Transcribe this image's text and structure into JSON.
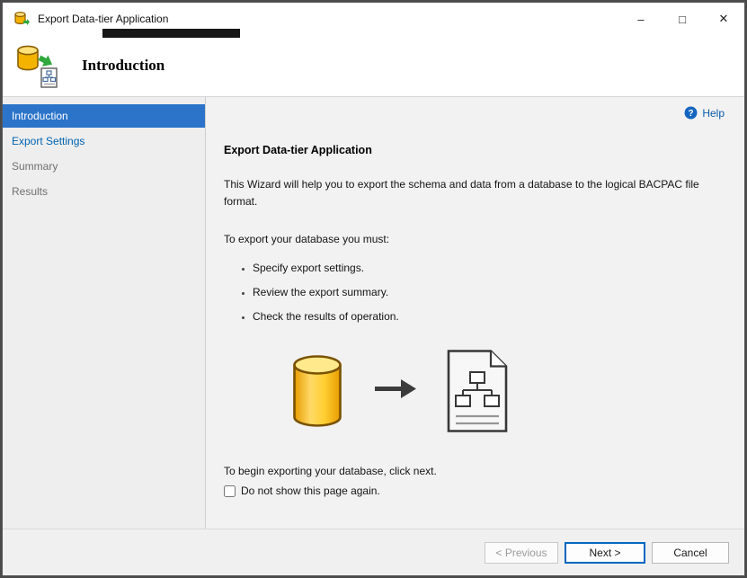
{
  "window": {
    "title": "Export Data-tier Application",
    "controls": {
      "minimize": "–",
      "maximize": "□",
      "close": "✕"
    }
  },
  "header": {
    "title": "Introduction"
  },
  "sidebar": {
    "items": [
      {
        "label": "Introduction",
        "state": "selected"
      },
      {
        "label": "Export Settings",
        "state": "link"
      },
      {
        "label": "Summary",
        "state": "disabled"
      },
      {
        "label": "Results",
        "state": "disabled"
      }
    ]
  },
  "content": {
    "help_label": "Help",
    "heading": "Export Data-tier Application",
    "description": "This Wizard will help you to export the schema and data from a database to the logical BACPAC file format.",
    "instruction": "To export your database you must:",
    "bullets": [
      "Specify export settings.",
      "Review the export summary.",
      "Check the results of operation."
    ],
    "footer_text": "To begin exporting your database, click next.",
    "checkbox_label": "Do not show this page again.",
    "checkbox_checked": false
  },
  "buttons": {
    "previous": "< Previous",
    "next": "Next >",
    "cancel": "Cancel"
  },
  "colors": {
    "accent": "#0067c0",
    "sidebar_selected_bg": "#2b74c9",
    "link": "#0063b1",
    "help_link": "#0b5cab",
    "database_yellow": "#ffd24a",
    "database_outline": "#8a5f00"
  }
}
